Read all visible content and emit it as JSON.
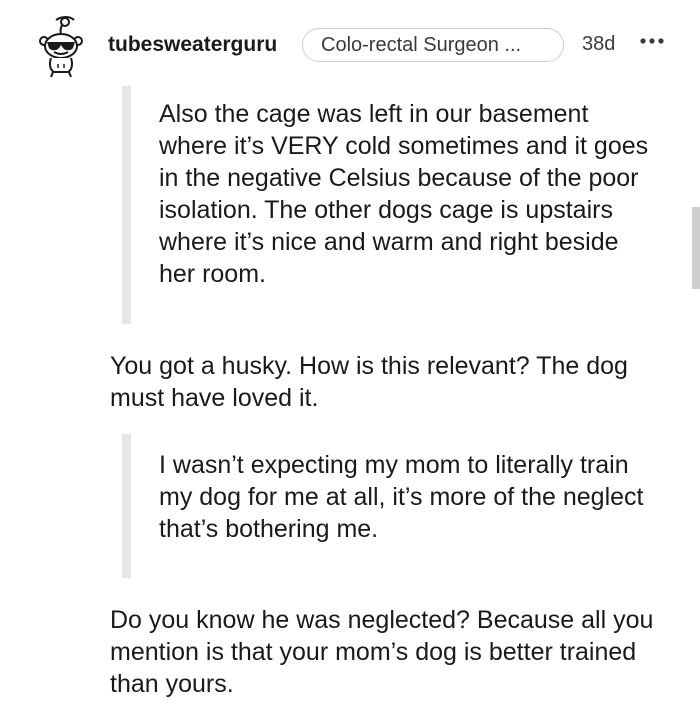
{
  "comment": {
    "username": "tubesweaterguru",
    "flair": "Colo-rectal Surgeon ...",
    "age": "38d",
    "more_label": "•••"
  },
  "body": {
    "quote_1": "Also the cage was left in our basement where it’s VERY cold sometimes and it goes in the negative Celsius because of the poor isolation. The other dogs cage is upstairs where it’s nice and warm and right beside her room.",
    "reply_1": "You got a husky. How is this relevant? The dog must have loved it.",
    "quote_2": "I wasn’t expecting my mom to literally train my dog for me at all, it’s more of the neglect that’s bothering me.",
    "reply_2": "Do you know he was neglected? Because all you mention is that your mom’s dog is better trained than yours."
  },
  "icons": {
    "avatar": "snoo-avatar-with-sunglasses-icon",
    "more": "more-options-icon"
  },
  "colors": {
    "text": "#1a1a1b",
    "quote_bar": "#e6e6e6",
    "flair_border": "#cfcfcf",
    "scrollbar": "#cfcfcf"
  }
}
